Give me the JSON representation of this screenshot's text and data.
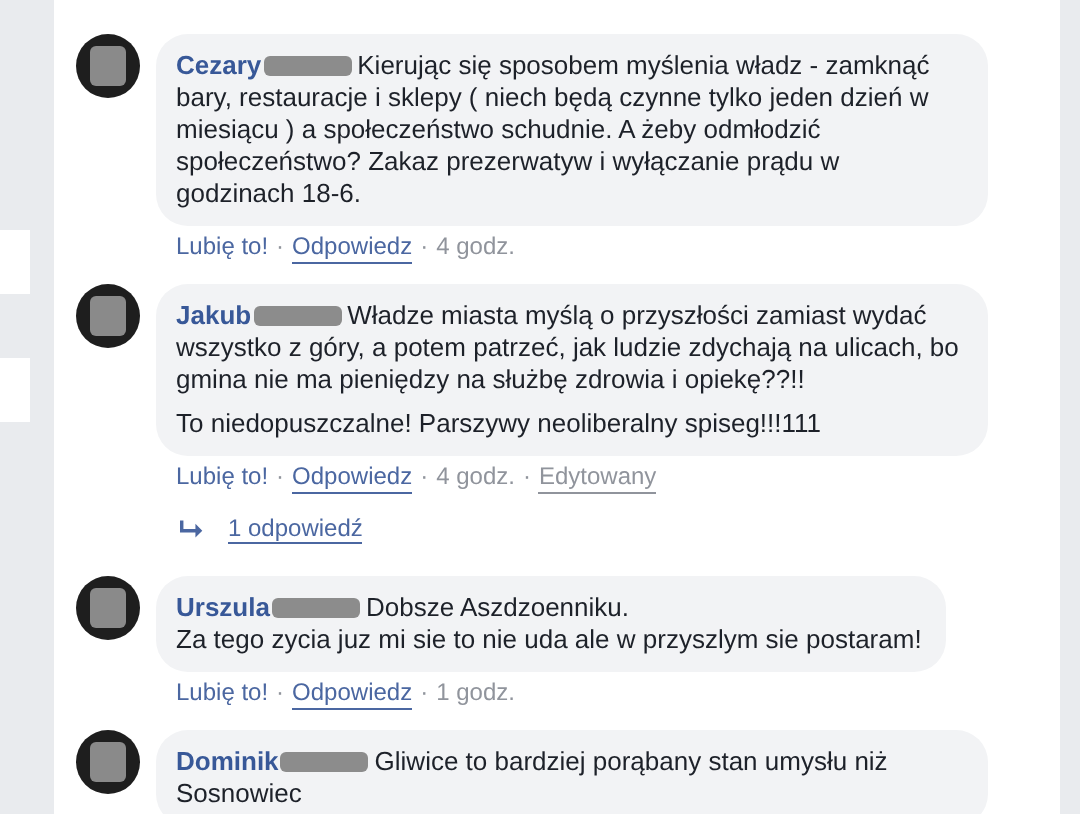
{
  "separator": "·",
  "comments": [
    {
      "author": "Cezary",
      "paragraphs": [
        "Kierując się sposobem myślenia władz - zamknąć bary, restauracje i sklepy ( niech będą czynne tylko jeden dzień w miesiącu ) a społeczeństwo schudnie. A żeby odmłodzić społeczeństwo? Zakaz prezerwatyw i wyłączanie prądu w godzinach 18-6."
      ],
      "actions": {
        "like": "Lubię to!",
        "reply": "Odpowiedz",
        "time": "4 godz."
      }
    },
    {
      "author": "Jakub",
      "paragraphs": [
        "Władze miasta myślą o przyszłości zamiast wydać wszystko z góry, a potem patrzeć, jak ludzie zdychają na ulicach, bo gmina nie ma pieniędzy na służbę zdrowia i opiekę??!!",
        "To niedopuszczalne! Parszywy neoliberalny spiseg!!!111"
      ],
      "actions": {
        "like": "Lubię to!",
        "reply": "Odpowiedz",
        "time": "4 godz.",
        "edited": "Edytowany"
      },
      "replies_link": "1 odpowiedź"
    },
    {
      "author": "Urszula",
      "paragraphs": [
        "Dobsze Aszdzoenniku.\nZa tego zycia juz mi sie to nie uda ale w przyszlym sie postaram!"
      ],
      "actions": {
        "like": "Lubię to!",
        "reply": "Odpowiedz",
        "time": "1 godz."
      }
    },
    {
      "author": "Dominik",
      "paragraphs": [
        "Gliwice to bardziej porąbany stan umysłu niż Sosnowiec"
      ]
    }
  ]
}
